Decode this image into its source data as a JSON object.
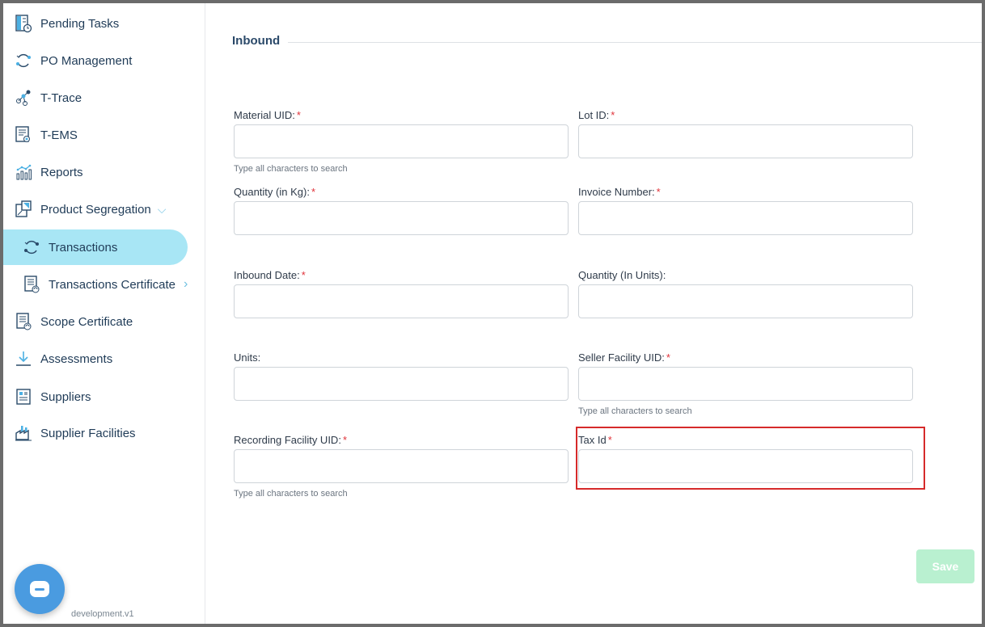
{
  "sidebar": {
    "items": [
      {
        "label": "Pending Tasks",
        "icon": "pending-tasks-icon"
      },
      {
        "label": "PO Management",
        "icon": "po-management-icon"
      },
      {
        "label": "T-Trace",
        "icon": "t-trace-icon"
      },
      {
        "label": "T-EMS",
        "icon": "t-ems-icon"
      },
      {
        "label": "Reports",
        "icon": "reports-icon"
      },
      {
        "label": "Product Segregation",
        "icon": "product-segregation-icon",
        "expanded": true
      },
      {
        "label": "Transactions",
        "icon": "transactions-icon",
        "active": true
      },
      {
        "label": "Transactions Certificate",
        "icon": "transactions-certificate-icon"
      },
      {
        "label": "Scope Certificate",
        "icon": "scope-certificate-icon"
      },
      {
        "label": "Assessments",
        "icon": "assessments-icon"
      },
      {
        "label": "Suppliers",
        "icon": "suppliers-icon"
      },
      {
        "label": "Supplier Facilities",
        "icon": "supplier-facilities-icon"
      }
    ],
    "version": "development.v1"
  },
  "form": {
    "section_title": "Inbound",
    "required_mark": "*",
    "hint_text": "Type all characters to search",
    "fields": {
      "material_uid": {
        "label": "Material UID:",
        "value": ""
      },
      "lot_id": {
        "label": "Lot ID:",
        "value": ""
      },
      "quantity_kg": {
        "label": "Quantity (in Kg):",
        "value": ""
      },
      "invoice_number": {
        "label": "Invoice Number:",
        "value": ""
      },
      "inbound_date": {
        "label": "Inbound Date:",
        "value": ""
      },
      "quantity_units": {
        "label": "Quantity (In Units):",
        "value": ""
      },
      "units": {
        "label": "Units:",
        "value": ""
      },
      "seller_facility_uid": {
        "label": "Seller Facility UID:",
        "value": ""
      },
      "recording_facility_uid": {
        "label": "Recording Facility UID:",
        "value": ""
      },
      "tax_id": {
        "label": "Tax Id",
        "value": ""
      }
    },
    "save_label": "Save"
  },
  "colors": {
    "active_nav": "#a8e6f5",
    "required": "#e0333a",
    "highlight": "#d62a2a",
    "save_button": "#b9f0d0",
    "chat_button": "#4a9be0"
  }
}
